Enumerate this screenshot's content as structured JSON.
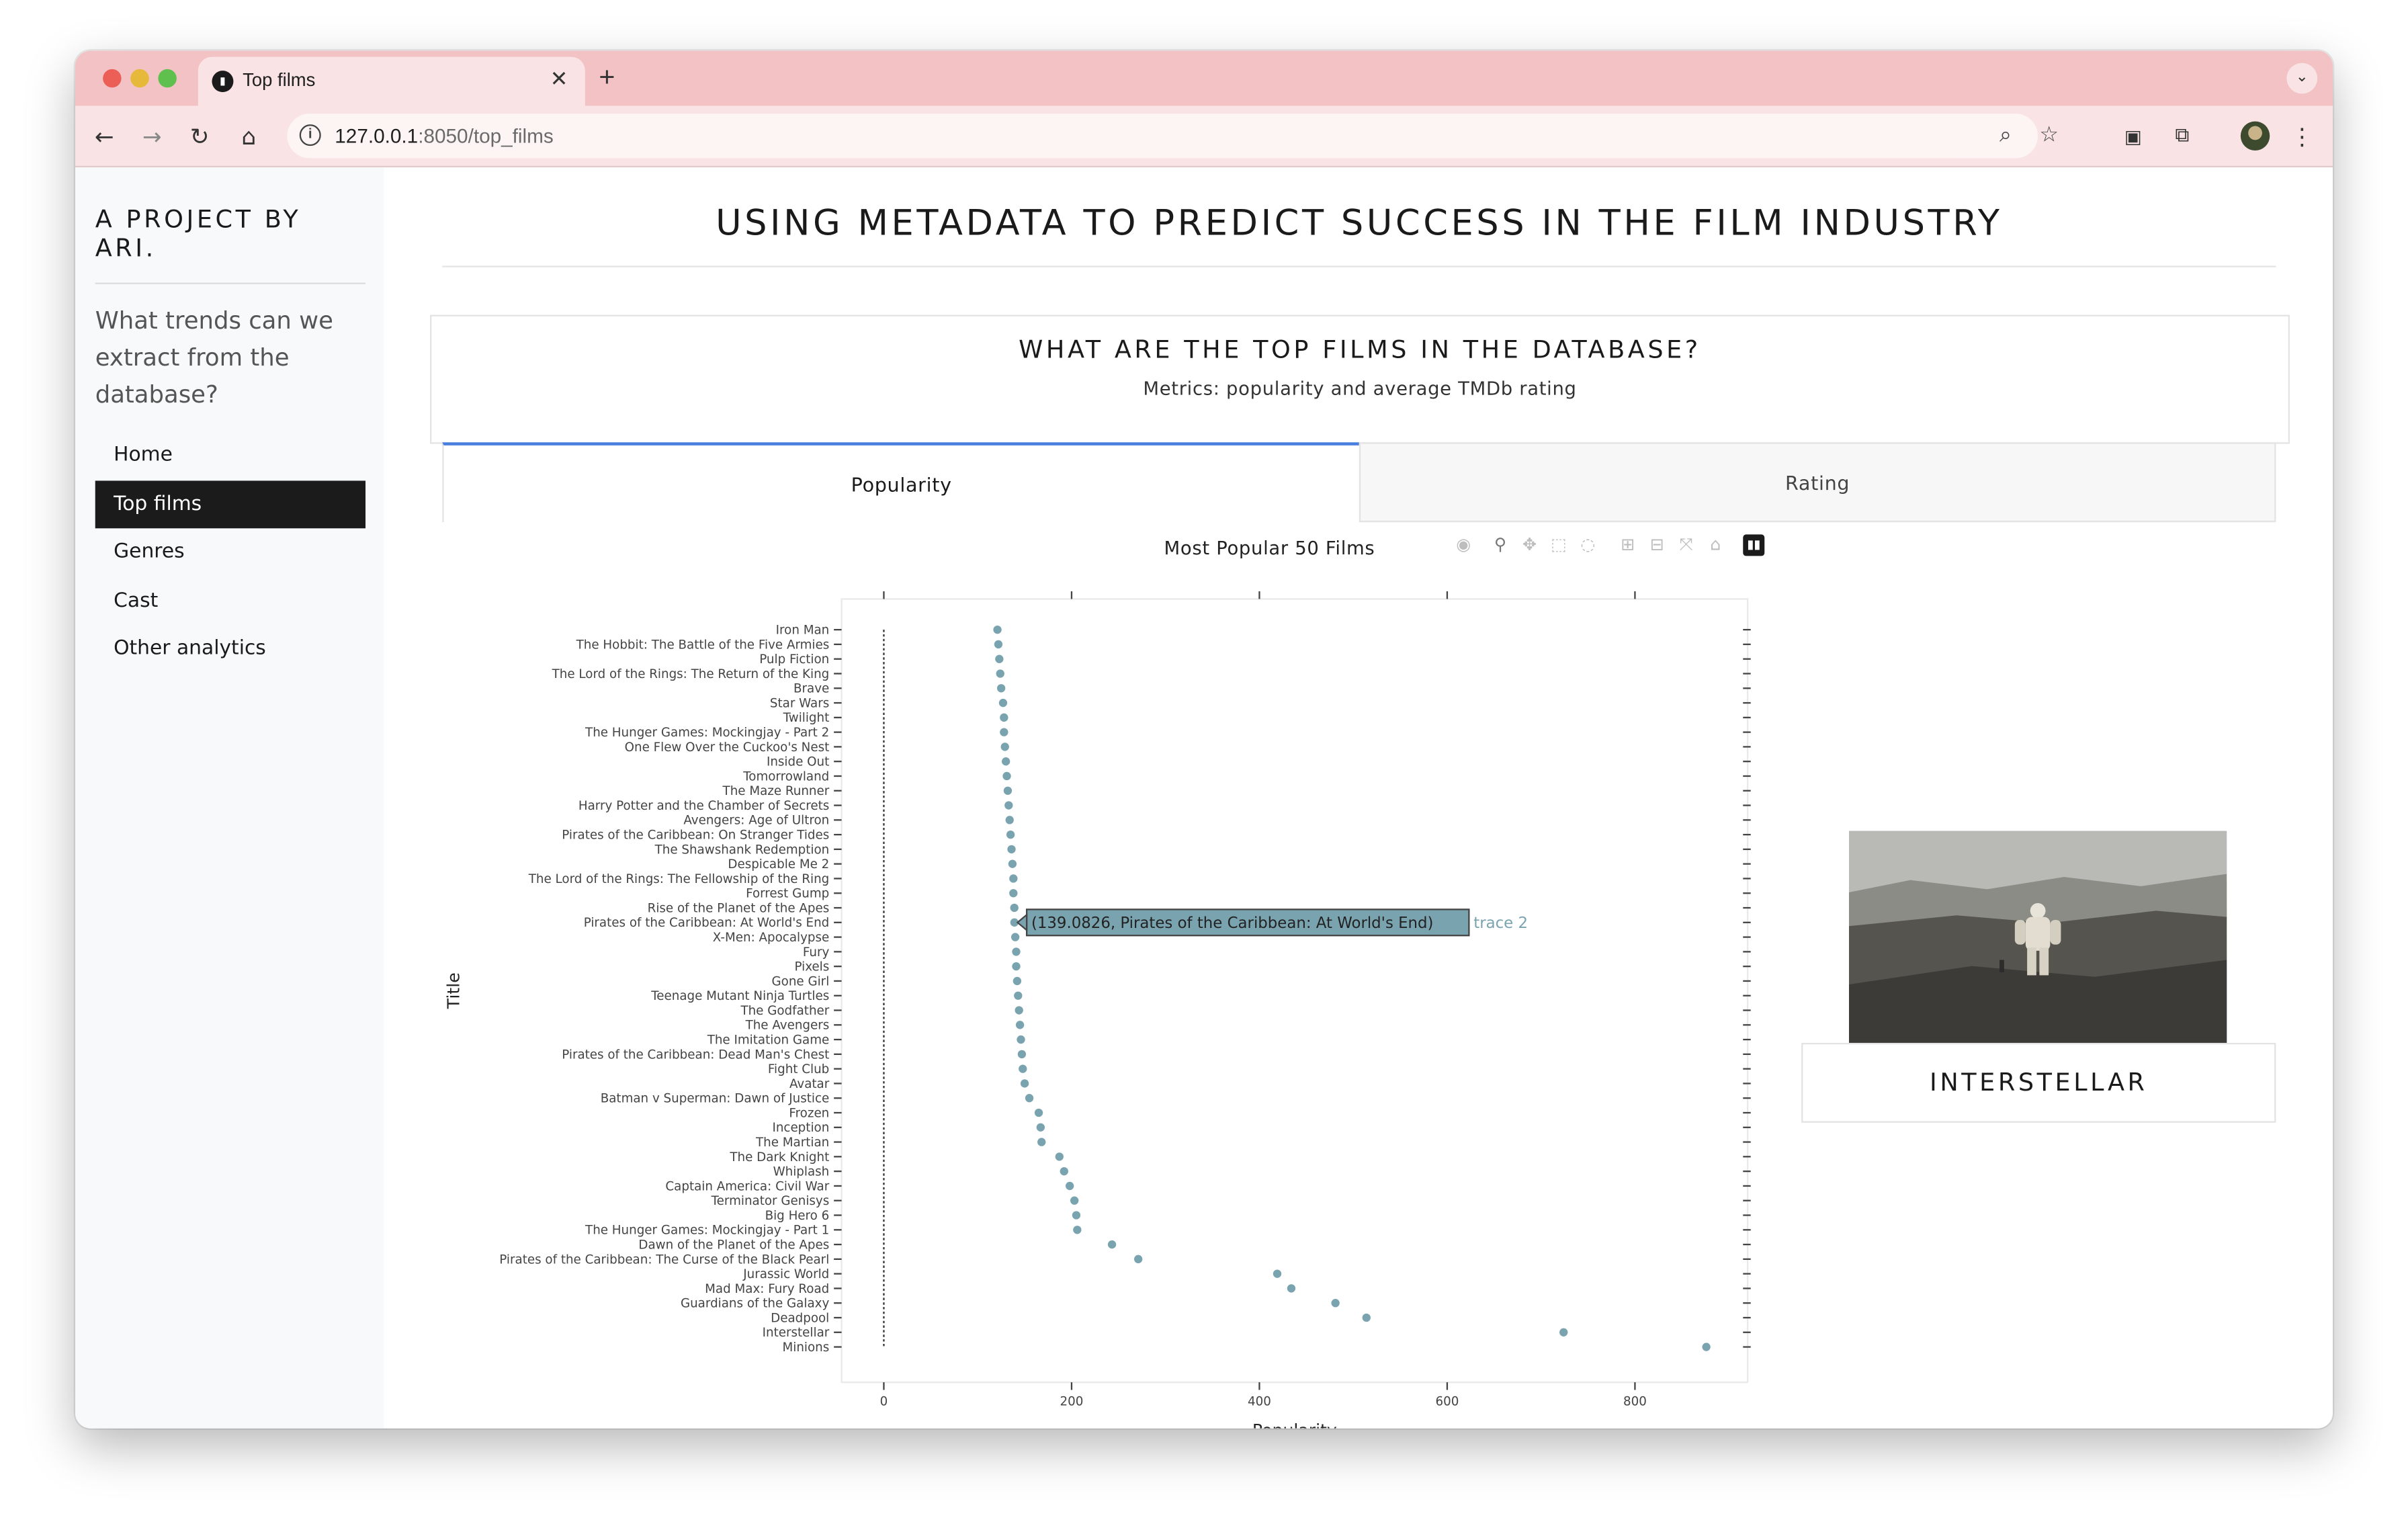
{
  "browser": {
    "tab_title": "Top films",
    "url_host": "127.0.0.1",
    "url_rest": ":8050/top_films",
    "new_tab_label": "+",
    "close_tab_label": "✕"
  },
  "sidebar": {
    "brand": "A PROJECT BY ARI.",
    "lead": "What trends can we extract from the database?",
    "items": [
      {
        "label": "Home",
        "active": false
      },
      {
        "label": "Top films",
        "active": true
      },
      {
        "label": "Genres",
        "active": false
      },
      {
        "label": "Cast",
        "active": false
      },
      {
        "label": "Other analytics",
        "active": false
      }
    ]
  },
  "main": {
    "title": "USING METADATA TO PREDICT SUCCESS IN THE FILM INDUSTRY",
    "card_title": "WHAT ARE THE TOP FILMS IN THE DATABASE?",
    "card_subtitle": "Metrics: popularity and average TMDb rating",
    "tabs": [
      {
        "label": "Popularity",
        "selected": true
      },
      {
        "label": "Rating",
        "selected": false
      }
    ],
    "poster_title": "INTERSTELLAR"
  },
  "colors": {
    "marker": "#7aa3b0",
    "tab_accent": "#4a7ede",
    "sidebar_active": "#1b1b1b"
  },
  "chart_data": {
    "type": "scatter",
    "title": "Most Popular 50 Films",
    "xlabel": "Popularity",
    "ylabel": "Title",
    "xlim": [
      -45,
      920
    ],
    "xticks": [
      0,
      200,
      400,
      600,
      800
    ],
    "grid": false,
    "categories": [
      "Iron Man",
      "The Hobbit: The Battle of the Five Armies",
      "Pulp Fiction",
      "The Lord of the Rings: The Return of the King",
      "Brave",
      "Star Wars",
      "Twilight",
      "The Hunger Games: Mockingjay - Part 2",
      "One Flew Over the Cuckoo's Nest",
      "Inside Out",
      "Tomorrowland",
      "The Maze Runner",
      "Harry Potter and the Chamber of Secrets",
      "Avengers: Age of Ultron",
      "Pirates of the Caribbean: On Stranger Tides",
      "The Shawshank Redemption",
      "Despicable Me 2",
      "The Lord of the Rings: The Fellowship of the Ring",
      "Forrest Gump",
      "Rise of the Planet of the Apes",
      "Pirates of the Caribbean: At World's End",
      "X-Men: Apocalypse",
      "Fury",
      "Pixels",
      "Gone Girl",
      "Teenage Mutant Ninja Turtles",
      "The Godfather",
      "The Avengers",
      "The Imitation Game",
      "Pirates of the Caribbean: Dead Man's Chest",
      "Fight Club",
      "Avatar",
      "Batman v Superman: Dawn of Justice",
      "Frozen",
      "Inception",
      "The Martian",
      "The Dark Knight",
      "Whiplash",
      "Captain America: Civil War",
      "Terminator Genisys",
      "Big Hero 6",
      "The Hunger Games: Mockingjay - Part 1",
      "Dawn of the Planet of the Apes",
      "Pirates of the Caribbean: The Curse of the Black Pearl",
      "Jurassic World",
      "Mad Max: Fury Road",
      "Guardians of the Galaxy",
      "Deadpool",
      "Interstellar",
      "Minions"
    ],
    "series": [
      {
        "name": "trace 2",
        "values": [
          121,
          122,
          123,
          124,
          125,
          127,
          128,
          128,
          129,
          130,
          131,
          132,
          133,
          134,
          135,
          136,
          137,
          138,
          138,
          139,
          139.0826,
          140,
          141,
          141,
          142,
          143,
          144,
          145,
          146,
          147,
          148,
          150,
          155,
          165,
          167,
          168,
          187,
          192,
          198,
          203,
          205,
          206,
          243,
          271,
          419,
          434,
          481,
          514,
          724,
          876
        ]
      },
      {
        "name": "baseline",
        "values": [
          0
        ]
      }
    ],
    "hover": {
      "text": "(139.0826, Pirates of the Caribbean: At World's End)",
      "trace": "trace 2",
      "index": 20
    }
  }
}
